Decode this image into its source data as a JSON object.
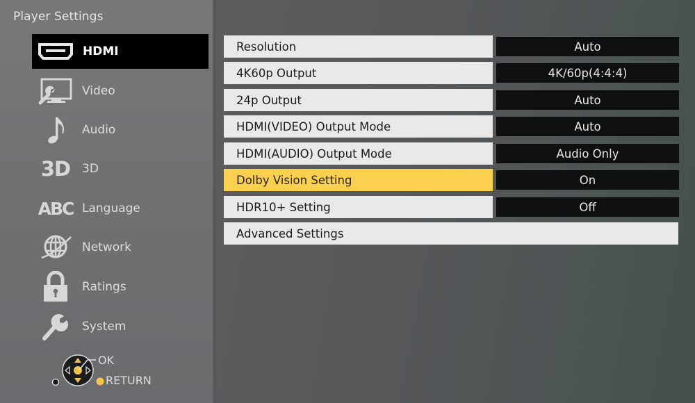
{
  "header": {
    "title": "Player Settings"
  },
  "sidebar": {
    "items": [
      {
        "label": "HDMI",
        "icon": "hdmi-port-icon",
        "active": true
      },
      {
        "label": "Video",
        "icon": "video-settings-icon"
      },
      {
        "label": "Audio",
        "icon": "music-note-icon"
      },
      {
        "label": "3D",
        "icon": "3d-icon",
        "glyph": "3D"
      },
      {
        "label": "Language",
        "icon": "language-abc-icon",
        "glyph": "ABC"
      },
      {
        "label": "Network",
        "icon": "globe-network-icon"
      },
      {
        "label": "Ratings",
        "icon": "padlock-icon"
      },
      {
        "label": "System",
        "icon": "wrench-icon"
      }
    ]
  },
  "settings": {
    "rows": [
      {
        "label": "Resolution",
        "value": "Auto"
      },
      {
        "label": "4K60p Output",
        "value": "4K/60p(4:4:4)"
      },
      {
        "label": "24p Output",
        "value": "Auto"
      },
      {
        "label": "HDMI(VIDEO) Output Mode",
        "value": "Auto"
      },
      {
        "label": "HDMI(AUDIO) Output Mode",
        "value": "Audio Only"
      },
      {
        "label": "Dolby Vision Setting",
        "value": "On",
        "focused": true
      },
      {
        "label": "HDR10+ Setting",
        "value": "Off"
      },
      {
        "label": "Advanced Settings"
      }
    ]
  },
  "nav_hints": {
    "ok_label": "OK",
    "return_label": "RETURN"
  },
  "colors": {
    "focus": "#fbd04e",
    "active_bg": "#000000",
    "value_bg": "#0d0f10",
    "row_bg": "#e9e9ea"
  }
}
